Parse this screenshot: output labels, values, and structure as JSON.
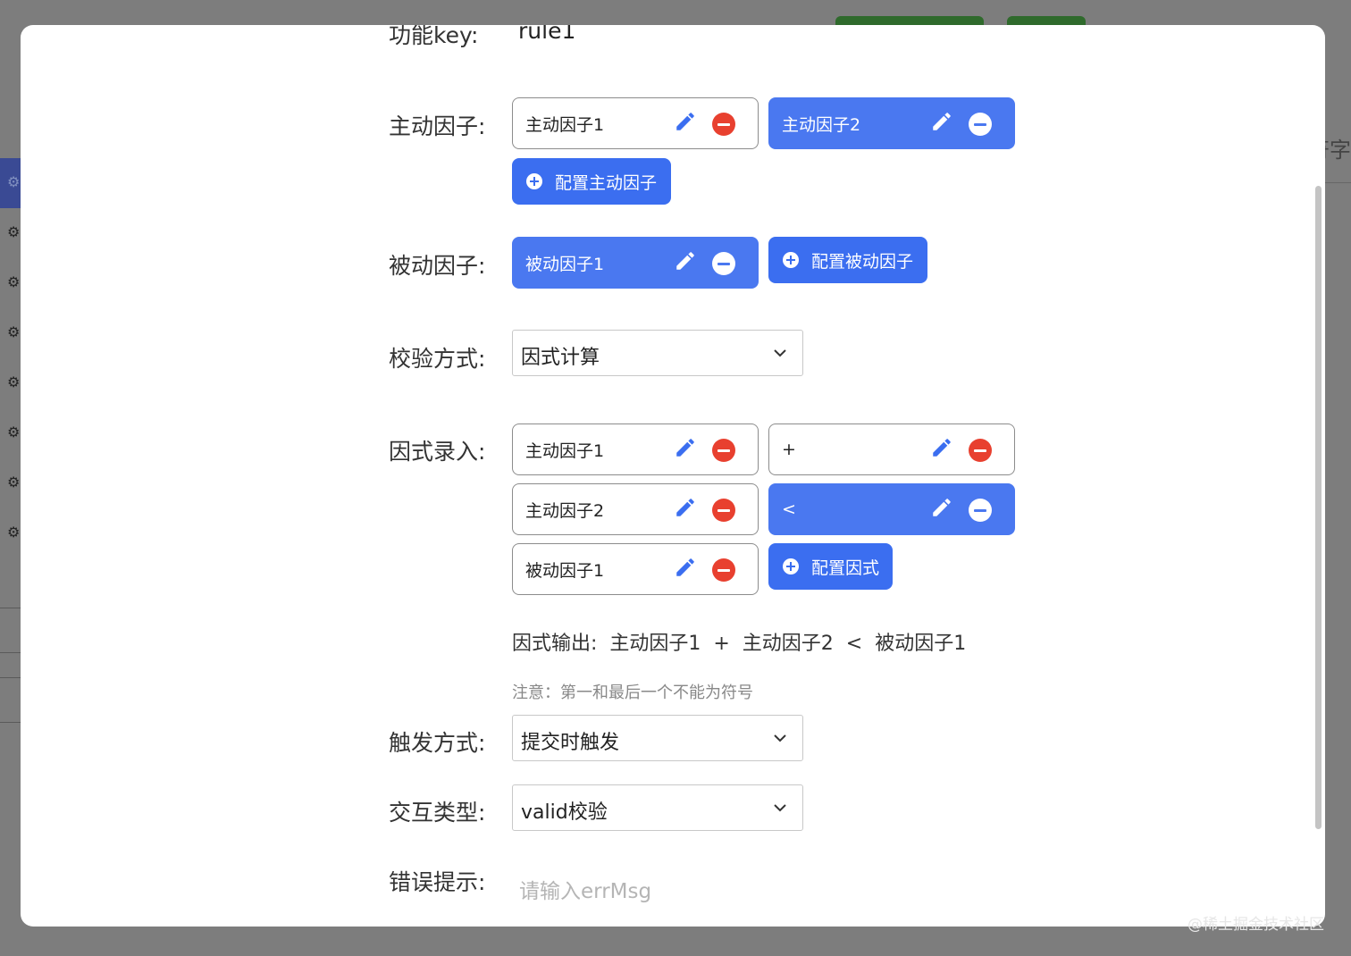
{
  "background": {
    "right_text": "符字"
  },
  "modal": {
    "function_key": {
      "label": "功能key:",
      "value": "rule1"
    },
    "active_factor": {
      "label": "主动因子:",
      "tags": [
        {
          "text": "主动因子1",
          "selected": false
        },
        {
          "text": "主动因子2",
          "selected": true
        }
      ],
      "add_button": "配置主动因子"
    },
    "passive_factor": {
      "label": "被动因子:",
      "tags": [
        {
          "text": "被动因子1",
          "selected": true
        }
      ],
      "add_button": "配置被动因子"
    },
    "check_method": {
      "label": "校验方式:",
      "value": "因式计算"
    },
    "formula_input": {
      "label": "因式录入:",
      "tags": [
        {
          "text": "主动因子1",
          "selected": false
        },
        {
          "text": "+",
          "selected": false
        },
        {
          "text": "主动因子2",
          "selected": false
        },
        {
          "text": "<",
          "selected": true
        },
        {
          "text": "被动因子1",
          "selected": false
        }
      ],
      "add_button": "配置因式"
    },
    "formula_output": "因式输出:  主动因子1  +  主动因子2  <  被动因子1",
    "note": "注意：第一和最后一个不能为符号",
    "trigger_method": {
      "label": "触发方式:",
      "value": "提交时触发"
    },
    "interaction_type": {
      "label": "交互类型:",
      "value": "valid校验"
    },
    "error_hint": {
      "label": "错误提示:",
      "placeholder": "请输入errMsg"
    }
  },
  "watermark": "@稀土掘金技术社区",
  "colors": {
    "primary": "#3b6ef0",
    "tag_active": "#4a78f0",
    "danger": "#e8402f"
  },
  "icons": {
    "edit": "pencil-icon",
    "remove": "minus-circle-icon",
    "add": "plus-circle-icon",
    "select": "chevron-down-icon"
  }
}
